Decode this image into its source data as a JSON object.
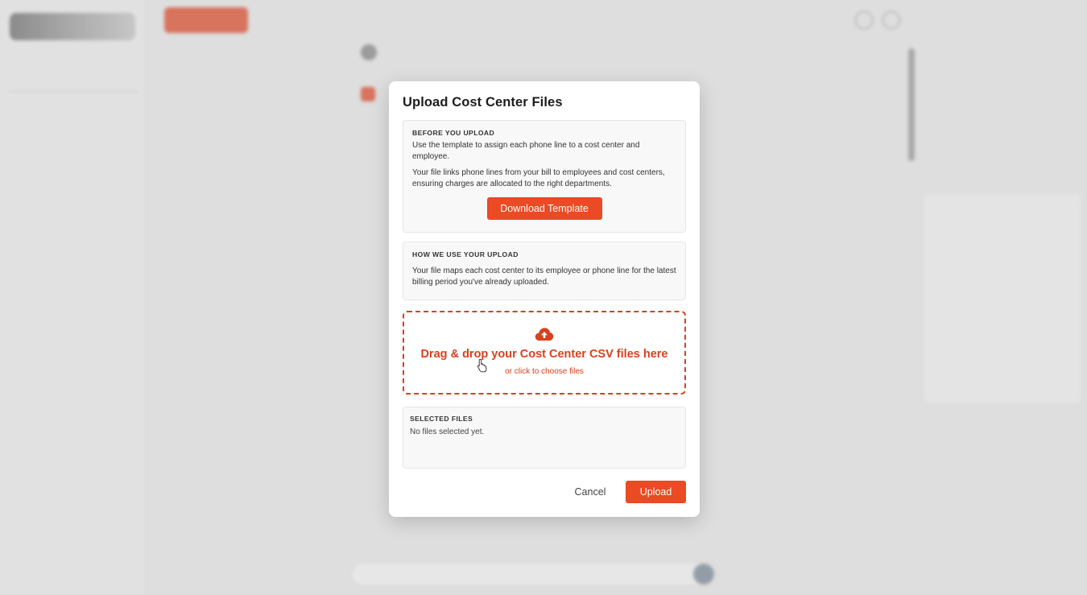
{
  "modal": {
    "title": "Upload Cost Center Files",
    "before_upload": {
      "heading": "BEFORE YOU UPLOAD",
      "text1": "Use the template to assign each phone line to a cost center and employee.",
      "text2": "Your file links phone lines from your bill to employees and cost centers, ensuring charges are allocated to the right departments.",
      "button_label": "Download Template"
    },
    "how_we_use": {
      "heading": "HOW WE USE YOUR UPLOAD",
      "text": "Your file maps each cost center to its employee or phone line for the latest billing period you've already uploaded."
    },
    "dropzone": {
      "main_text": "Drag & drop your Cost Center CSV files here",
      "sub_text": "or click to choose files",
      "icon": "cloud-upload-icon"
    },
    "selected_files": {
      "heading": "SELECTED FILES",
      "empty_text": "No files selected yet."
    },
    "cancel_label": "Cancel",
    "upload_label": "Upload"
  },
  "colors": {
    "accent": "#ea4a24",
    "dropzone_border": "#d8411f",
    "box_background": "#f8f8f8"
  }
}
